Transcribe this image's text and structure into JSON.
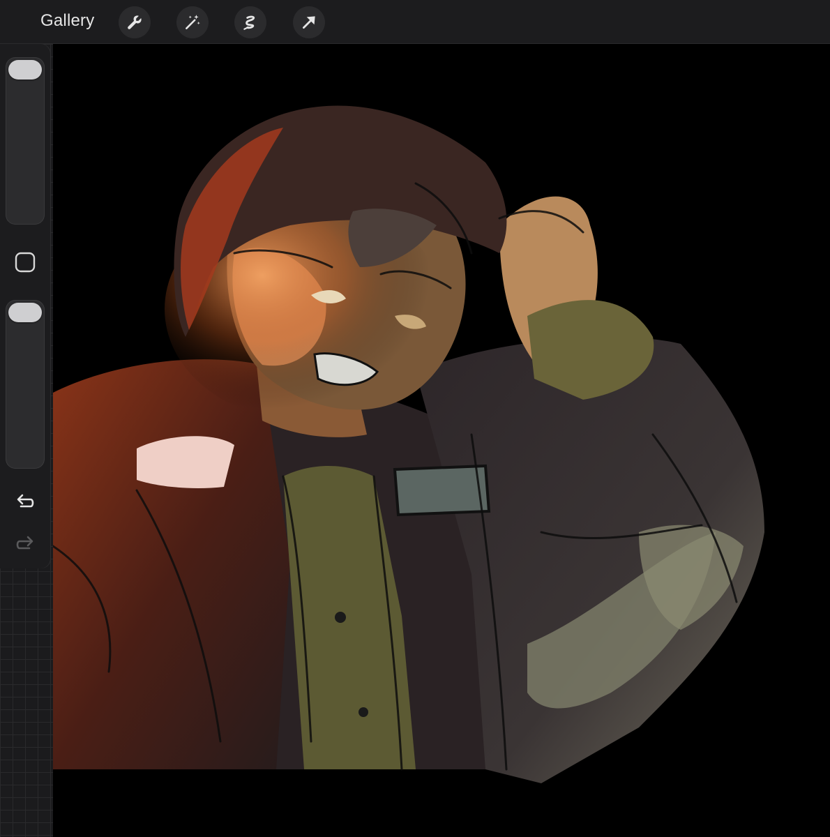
{
  "toolbar": {
    "gallery_label": "Gallery",
    "tools": [
      {
        "name": "actions",
        "icon": "wrench-icon"
      },
      {
        "name": "adjustments",
        "icon": "magic-wand-icon"
      },
      {
        "name": "selection",
        "icon": "selection-icon"
      },
      {
        "name": "transform",
        "icon": "arrow-icon"
      }
    ]
  },
  "sidebar": {
    "brush_size_level": 1.0,
    "brush_opacity_level": 1.0,
    "modify_button_icon": "square-icon",
    "undo_icon": "undo-icon",
    "redo_icon": "redo-icon",
    "redo_enabled": false
  },
  "canvas": {
    "background_color": "#000000",
    "artwork_description_colors": {
      "hair": "#3a2420",
      "hair_highlight": "#c2461f",
      "skin_lit": "#e59a63",
      "skin_shadow": "#6b5a3c",
      "jacket_red": "#7a2a14",
      "jacket_dark": "#2b2526",
      "shirt_olive": "#6f6a3d",
      "sleeve_light": "#8a8a70"
    }
  },
  "colors": {
    "toolbar_bg": "#1c1c1e",
    "button_bg": "#2b2b2d",
    "icon": "#e6e6e6",
    "slider_thumb": "#cfcfd1"
  }
}
